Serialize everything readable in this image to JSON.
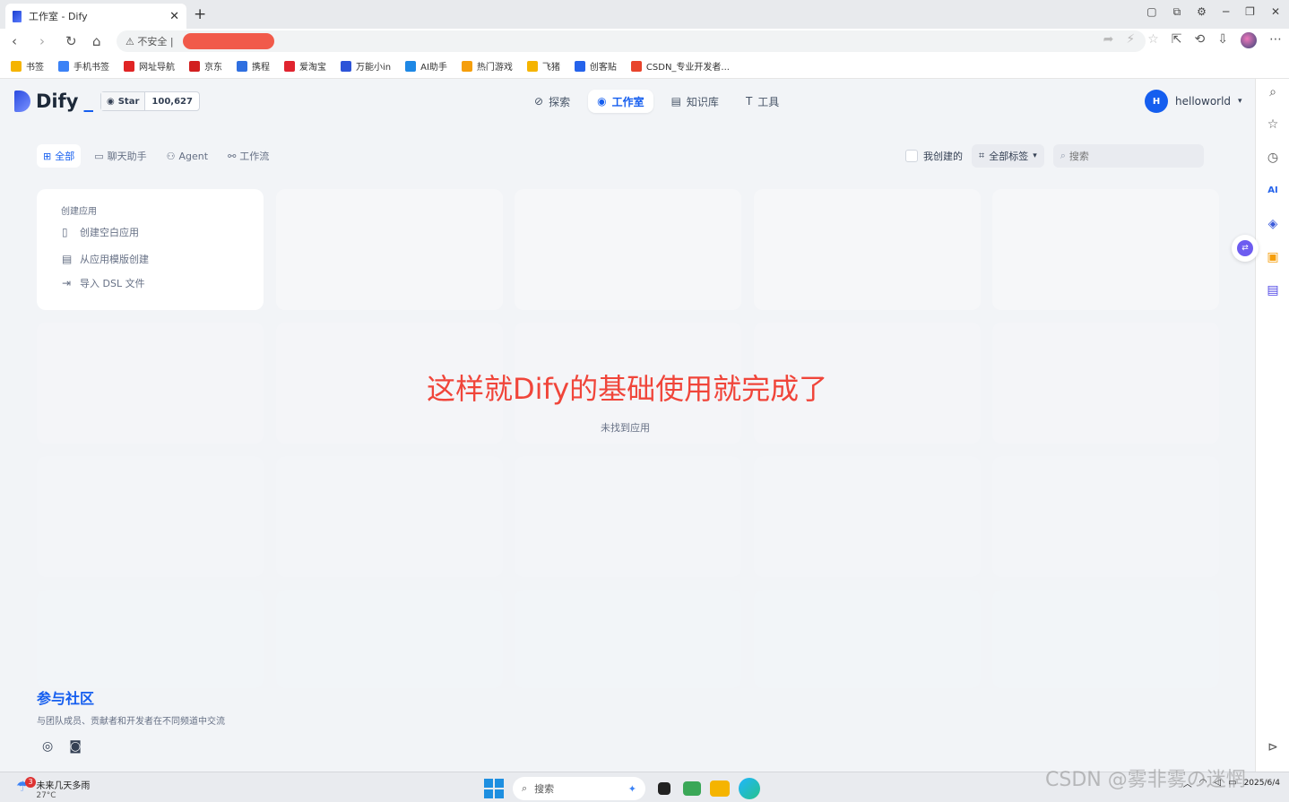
{
  "browser": {
    "tab_title": "工作室 - Dify",
    "tab_close": "✕",
    "new_tab": "+",
    "security_label": "不安全",
    "bookmarks": [
      {
        "label": "书签",
        "color": "#f5b400"
      },
      {
        "label": "手机书签",
        "color": "#3b82f6"
      },
      {
        "label": "网址导航",
        "color": "#e02424"
      },
      {
        "label": "京东",
        "color": "#d21f1f"
      },
      {
        "label": "携程",
        "color": "#2f6fe0"
      },
      {
        "label": "爱淘宝",
        "color": "#e0242f"
      },
      {
        "label": "万能小in",
        "color": "#2d54d8"
      },
      {
        "label": "AI助手",
        "color": "#1e88e5"
      },
      {
        "label": "热门游戏",
        "color": "#f59e0b"
      },
      {
        "label": "飞猪",
        "color": "#f5b400"
      },
      {
        "label": "创客贴",
        "color": "#2563eb"
      },
      {
        "label": "CSDN_专业开发者...",
        "color": "#e8442c"
      }
    ]
  },
  "header": {
    "logo_text": "Dify",
    "github_star_label": "Star",
    "github_star_count": "100,627",
    "nav": [
      {
        "label": "探索",
        "icon": "compass-icon",
        "active": false
      },
      {
        "label": "工作室",
        "icon": "robot-icon",
        "active": true
      },
      {
        "label": "知识库",
        "icon": "book-icon",
        "active": false
      },
      {
        "label": "工具",
        "icon": "hammer-icon",
        "active": false
      }
    ],
    "user_initial": "H",
    "user_name": "helloworld"
  },
  "filters": {
    "tabs": [
      {
        "label": "全部",
        "active": true
      },
      {
        "label": "聊天助手",
        "active": false
      },
      {
        "label": "Agent",
        "active": false
      },
      {
        "label": "工作流",
        "active": false
      }
    ],
    "created_by_me": "我创建的",
    "all_tags": "全部标签",
    "search_placeholder": "搜索"
  },
  "create_card": {
    "title": "创建应用",
    "items": [
      {
        "label": "创建空白应用"
      },
      {
        "label": "从应用模版创建"
      },
      {
        "label": "导入 DSL 文件"
      }
    ]
  },
  "annotation": "这样就Dify的基础使用就完成了",
  "empty_state": "未找到应用",
  "community": {
    "title": "参与社区",
    "desc": "与团队成员、贡献者和开发者在不同频道中交流"
  },
  "taskbar": {
    "weather_badge": "3",
    "weather_title": "未来几天多雨",
    "weather_temp": "27°C",
    "search_label": "搜索",
    "date": "2025/6/4"
  },
  "watermark": "CSDN @雾非雾の迷惘",
  "colors": {
    "accent": "#155eef",
    "annotation": "#f0453a",
    "background": "#f2f4f7"
  }
}
